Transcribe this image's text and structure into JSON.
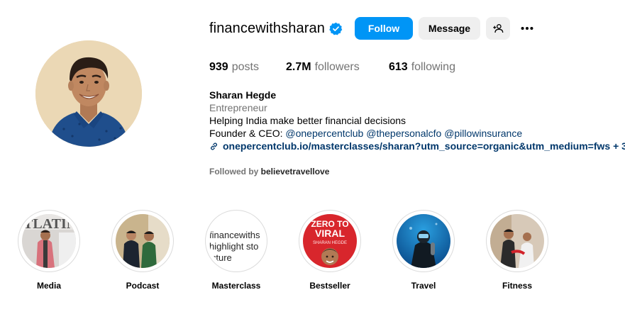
{
  "profile": {
    "username": "financewithsharan",
    "verified": true,
    "follow_label": "Follow",
    "message_label": "Message",
    "stats": {
      "posts_count": "939",
      "posts_label": "posts",
      "followers_count": "2.7M",
      "followers_label": "followers",
      "following_count": "613",
      "following_label": "following"
    },
    "bio": {
      "full_name": "Sharan Hegde",
      "category": "Entrepreneur",
      "line1": "Helping India make better financial decisions",
      "founder_prefix": "Founder & CEO: ",
      "mentions": [
        "@onepercentclub",
        "@thepersonalcfo",
        "@pillowinsurance"
      ],
      "link_text": "onepercentclub.io/masterclasses/sharan?utm_source=organic&utm_medium=fws + 3"
    },
    "followed_by_prefix": "Followed by ",
    "followed_by_user": "believetravellove"
  },
  "highlights": [
    {
      "label": "Media"
    },
    {
      "label": "Podcast"
    },
    {
      "label": "Masterclass",
      "thumb_text": "financewiths\nhighlight sto\nicture"
    },
    {
      "label": "Bestseller",
      "thumb_text_1": "ZERO TO",
      "thumb_text_2": "VIRAL",
      "thumb_text_3": "SHARAN HEGDE"
    },
    {
      "label": "Travel"
    },
    {
      "label": "Fitness"
    }
  ],
  "colors": {
    "accent": "#0095f6",
    "secondary_button": "#efefef",
    "muted_text": "#737373",
    "link": "#00376b"
  }
}
